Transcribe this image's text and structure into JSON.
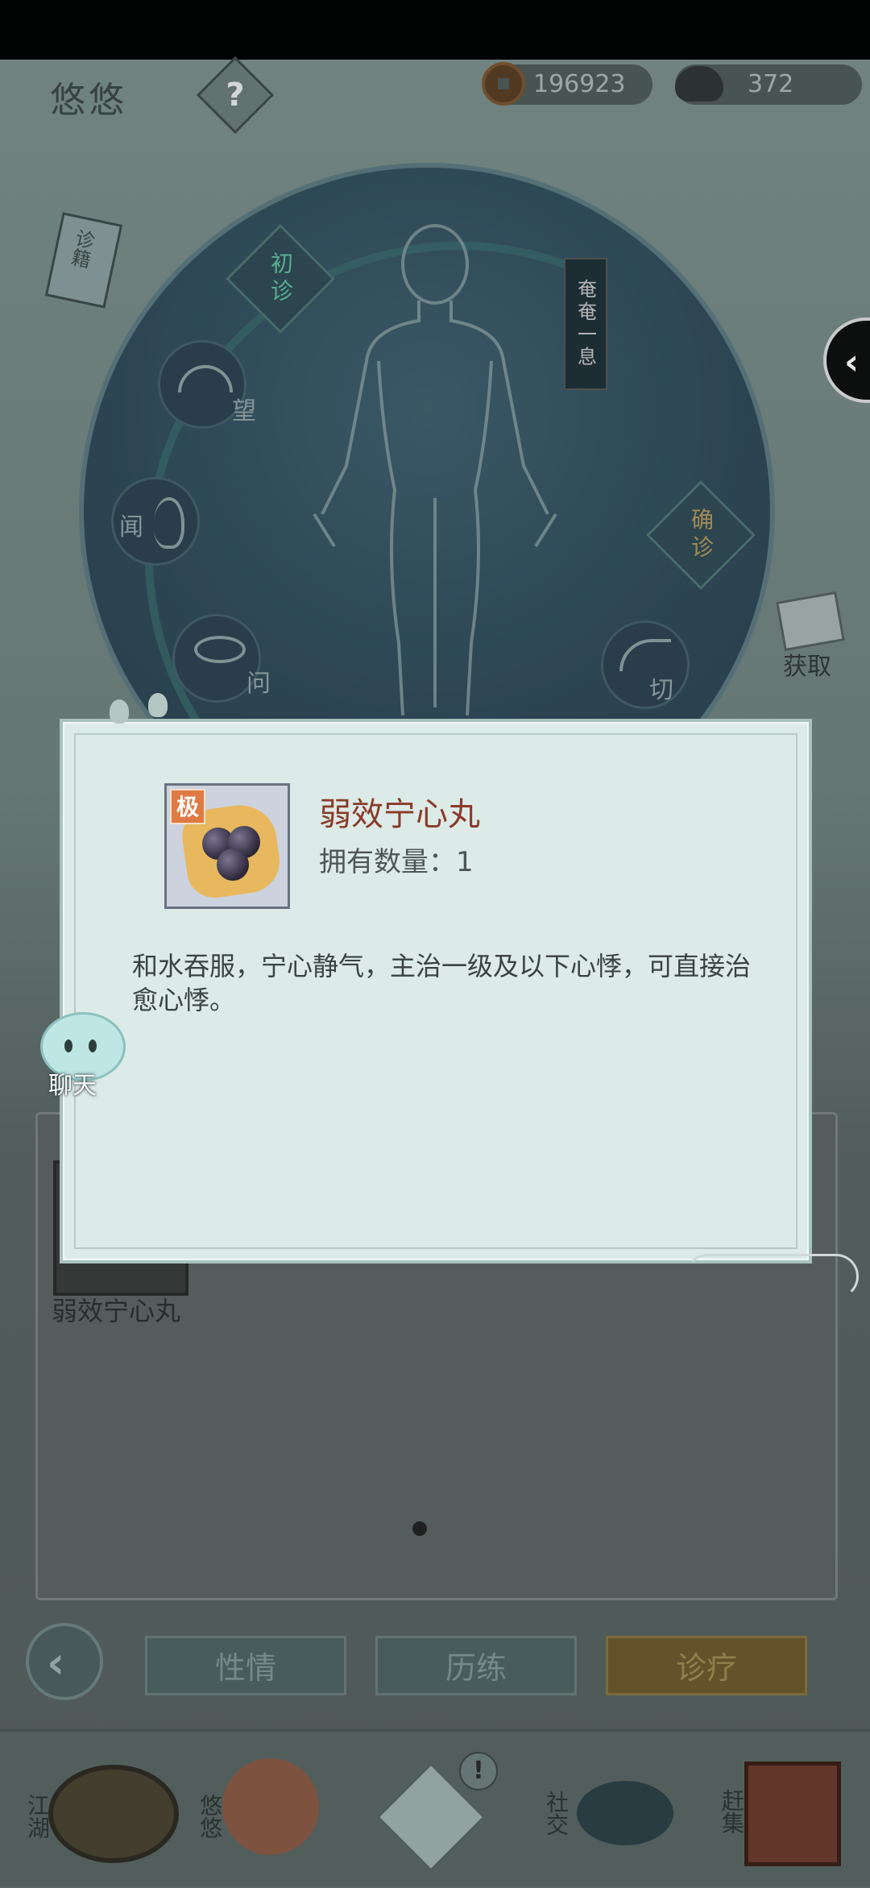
{
  "header": {
    "player_name": "悠悠",
    "help_label": "?",
    "copper_coins": "196923",
    "silver": "372"
  },
  "scene": {
    "book_label": "诊籍",
    "banner_text": "奄奄一息",
    "chuzhen_label": "初诊",
    "quezhen_label": "确诊",
    "wang_label": "望",
    "wen_label": "闻",
    "wen2_label": "问",
    "qie_label": "切",
    "get_label": "获取",
    "chat_label": "聊天"
  },
  "inventory": {
    "item_label": "弱效宁心丸"
  },
  "tabs": {
    "xingqing": "性情",
    "lilian": "历练",
    "zhenliao": "诊疗"
  },
  "nav": {
    "jianghu": "江湖",
    "youyou": "悠悠",
    "notice": "!",
    "shejiao": "社交",
    "ganji": "赶集"
  },
  "modal": {
    "grade_badge": "极",
    "item_name": "弱效宁心丸",
    "count_text": "拥有数量：1",
    "description": "和水吞服，宁心静气，主治一级及以下心悸，可直接治愈心悸。"
  },
  "colors": {
    "item_name": "#8a3a2a",
    "active_tab": "#6e5a2c",
    "modal_bg": "#dcebe7"
  },
  "icons": [
    "help-icon",
    "copper-coin-icon",
    "silver-ingot-icon",
    "back-arrow-icon",
    "collapse-arrow-icon",
    "pill-icon",
    "chat-icon"
  ]
}
